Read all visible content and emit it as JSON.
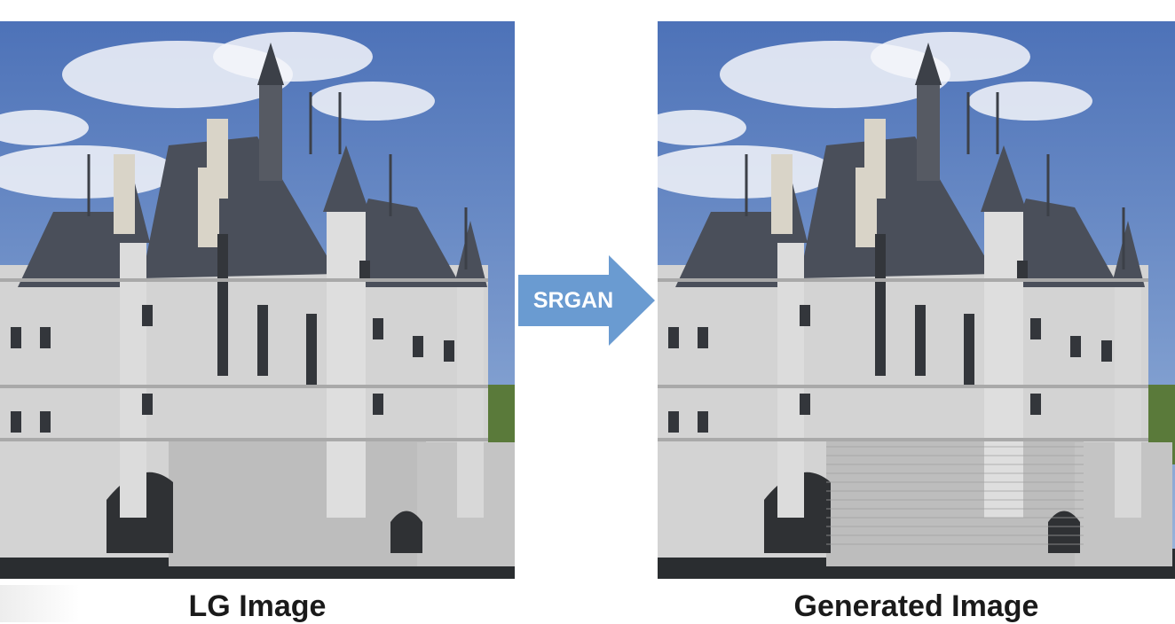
{
  "images": {
    "left_caption": "LG Image",
    "right_caption": "Generated Image"
  },
  "process": {
    "label": "SRGAN",
    "arrow_color": "#6a9bd1"
  },
  "palette": {
    "sky_top": "#4d72b8",
    "sky_bottom": "#9bb6dc",
    "cloud": "#f4f6fa",
    "stone": "#d3d3d3",
    "roof": "#4a4f5a",
    "water": "#2a2d30",
    "trees": "#5a7a3a"
  },
  "illustration": "chateau-de-chenonceau"
}
